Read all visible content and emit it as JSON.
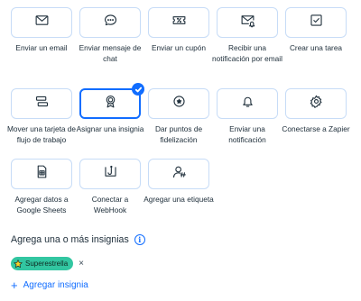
{
  "actions": [
    {
      "label": "Enviar un email",
      "icon": "envelope-icon"
    },
    {
      "label": "Enviar mensaje de chat",
      "icon": "chat-bubble-icon"
    },
    {
      "label": "Enviar un cupón",
      "icon": "coupon-icon"
    },
    {
      "label": "Recibir una notificación por email",
      "icon": "email-bell-icon"
    },
    {
      "label": "Crear una tarea",
      "icon": "checkbox-icon"
    },
    {
      "label": "Mover una tarjeta de flujo de trabajo",
      "icon": "workflow-card-icon"
    },
    {
      "label": "Asignar una insignia",
      "icon": "badge-ribbon-icon",
      "selected": true
    },
    {
      "label": "Dar puntos de fidelización",
      "icon": "loyalty-points-icon"
    },
    {
      "label": "Enviar una notificación",
      "icon": "bell-icon"
    },
    {
      "label": "Conectarse a Zapier",
      "icon": "zapier-gear-icon"
    },
    {
      "label": "Agregar datos a Google Sheets",
      "icon": "spreadsheet-icon"
    },
    {
      "label": "Conectar a WebHook",
      "icon": "webhook-icon"
    },
    {
      "label": "Agregar una etiqueta",
      "icon": "contact-tag-icon"
    }
  ],
  "badges_section": {
    "title": "Agrega una o más insignias",
    "info_glyph": "i",
    "badges": [
      {
        "label": "Superestrella",
        "icon": "star-icon",
        "color": "#32c6a1"
      }
    ],
    "remove_glyph": "×",
    "add_label": "Agregar insignia",
    "add_glyph": "+"
  },
  "colors": {
    "accent": "#116dff",
    "card_border": "#c7dcf7",
    "badge": "#32c6a1"
  }
}
